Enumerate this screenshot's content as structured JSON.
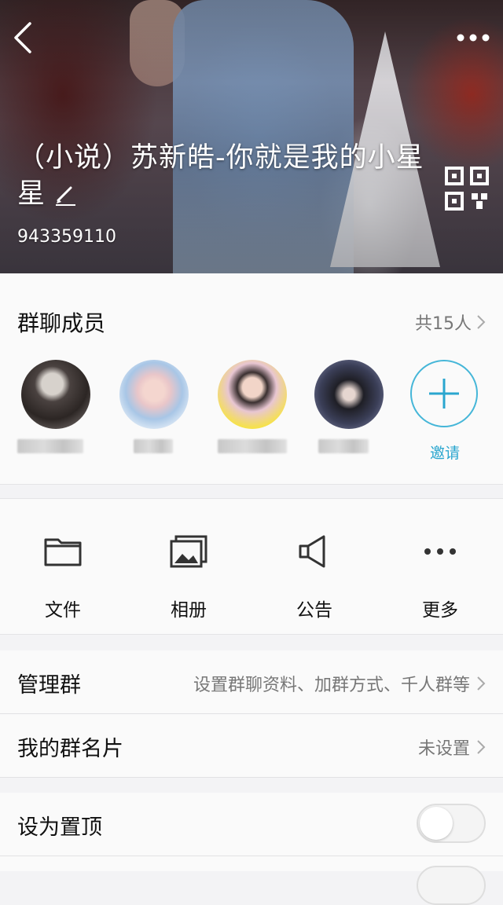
{
  "header": {
    "title": "（小说）苏新皓-你就是我的小星星",
    "group_id": "943359110"
  },
  "members": {
    "title": "群聊成员",
    "count": "共15人",
    "invite_label": "邀请"
  },
  "functions": [
    {
      "label": "文件",
      "icon": "folder-icon"
    },
    {
      "label": "相册",
      "icon": "photo-album-icon"
    },
    {
      "label": "公告",
      "icon": "megaphone-icon"
    },
    {
      "label": "更多",
      "icon": "more-dots-icon"
    }
  ],
  "settings": {
    "manage": {
      "label": "管理群",
      "value": "设置群聊资料、加群方式、千人群等"
    },
    "card": {
      "label": "我的群名片",
      "value": "未设置"
    },
    "pin": {
      "label": "设为置顶",
      "on": false
    }
  },
  "colors": {
    "accent": "#2aa6cf"
  }
}
